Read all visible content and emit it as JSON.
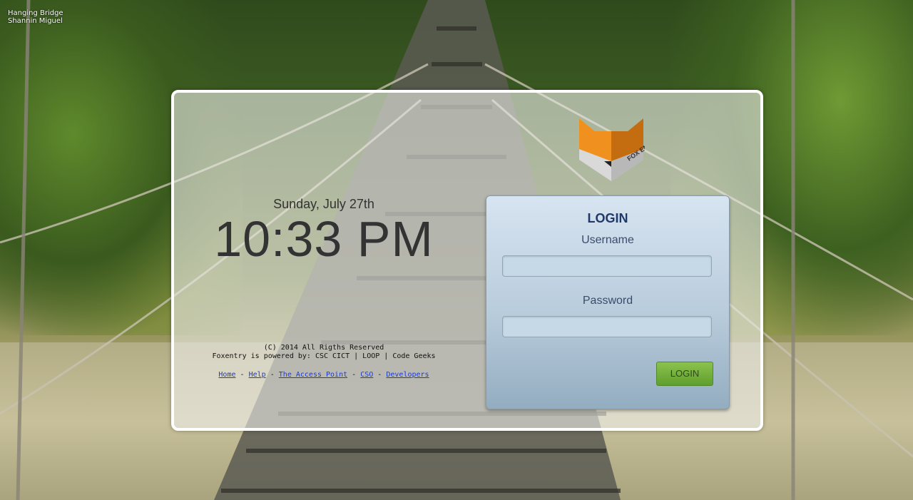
{
  "photo_credit": {
    "title": "Hanging Bridge",
    "author": "Shannin Miguel"
  },
  "clock": {
    "date": "Sunday, July 27th",
    "time": "10:33 PM"
  },
  "footer": {
    "copyright": "(C) 2014 All Rigths Reserved",
    "powered_by": "Foxentry is powered by: CSC CICT | LOOP | Code Geeks",
    "links": [
      {
        "label": "Home"
      },
      {
        "label": "Help"
      },
      {
        "label": "The Access Point"
      },
      {
        "label": "CSO"
      },
      {
        "label": "Developers"
      }
    ],
    "separator": "-"
  },
  "logo": {
    "icon": "fox-entry-logo",
    "text": "FOX ENTRY"
  },
  "login": {
    "title": "LOGIN",
    "username_label": "Username",
    "username_value": "",
    "password_label": "Password",
    "password_value": "",
    "button_label": "LOGIN"
  },
  "colors": {
    "panel_border": "#ffffff",
    "login_title": "#1f3a6a",
    "button_green": "#6aa83a",
    "link_blue": "#1a3ad6",
    "fox_orange": "#f0901e"
  }
}
